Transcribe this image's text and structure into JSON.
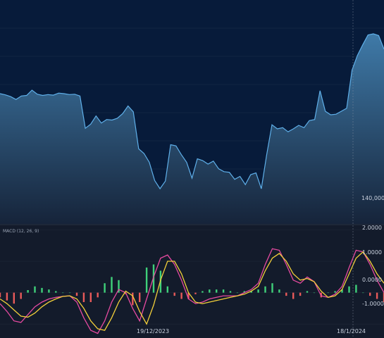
{
  "chart_data": [
    {
      "type": "area",
      "title": "",
      "x": [
        "2023-11-16",
        "2023-11-17",
        "2023-11-18",
        "2023-11-19",
        "2023-11-20",
        "2023-11-21",
        "2023-11-22",
        "2023-11-23",
        "2023-11-24",
        "2023-11-25",
        "2023-11-26",
        "2023-11-27",
        "2023-11-28",
        "2023-11-29",
        "2023-11-30",
        "2023-12-01",
        "2023-12-02",
        "2023-12-03",
        "2023-12-04",
        "2023-12-05",
        "2023-12-06",
        "2023-12-07",
        "2023-12-08",
        "2023-12-09",
        "2023-12-10",
        "2023-12-11",
        "2023-12-12",
        "2023-12-13",
        "2023-12-14",
        "2023-12-15",
        "2023-12-16",
        "2023-12-17",
        "2023-12-18",
        "2023-12-19",
        "2023-12-20",
        "2023-12-21",
        "2023-12-22",
        "2023-12-23",
        "2023-12-24",
        "2023-12-25",
        "2023-12-26",
        "2023-12-27",
        "2023-12-28",
        "2023-12-29",
        "2023-12-30",
        "2023-12-31",
        "2024-01-01",
        "2024-01-02",
        "2024-01-03",
        "2024-01-04",
        "2024-01-05",
        "2024-01-06",
        "2024-01-07",
        "2024-01-08",
        "2024-01-09",
        "2024-01-10",
        "2024-01-11",
        "2024-01-12",
        "2024-01-13",
        "2024-01-14",
        "2024-01-15",
        "2024-01-16",
        "2024-01-17",
        "2024-01-18",
        "2024-01-19",
        "2024-01-20",
        "2024-01-21",
        "2024-01-22",
        "2024-01-23",
        "2024-01-24"
      ],
      "values": [
        148000,
        147980,
        147950,
        147900,
        147960,
        147970,
        148060,
        147990,
        147970,
        147985,
        147975,
        148010,
        148000,
        147985,
        147990,
        147960,
        147410,
        147480,
        147620,
        147500,
        147560,
        147550,
        147580,
        147660,
        147790,
        147690,
        147060,
        146980,
        146830,
        146520,
        146380,
        146510,
        147130,
        147110,
        146960,
        146830,
        146560,
        146890,
        146860,
        146800,
        146850,
        146720,
        146670,
        146660,
        146540,
        146590,
        146450,
        146620,
        146650,
        146380,
        146960,
        147470,
        147400,
        147420,
        147350,
        147400,
        147460,
        147420,
        147540,
        147560,
        148050,
        147700,
        147640,
        147650,
        147700,
        147750,
        148400,
        148650,
        148830,
        149000,
        149020,
        148990,
        148760
      ],
      "ytick_labels": [
        "140,0000"
      ],
      "xtick_labels": [
        "19/12/2023",
        "18/1/2024"
      ],
      "grid": true,
      "line_color": "#5fb0ea",
      "fill_top": "#3f7aa8",
      "fill_bottom": "#16243a",
      "background": "#071b3a"
    },
    {
      "type": "line",
      "title": "MACD (12, 26, 9)",
      "ytick_labels": [
        "2.0000",
        "1.0000",
        "0.0000",
        "-1.0000"
      ],
      "ylim": [
        -1.4,
        2.1
      ],
      "series": [
        {
          "name": "",
          "color": "#e54aa0",
          "values": [
            -0.35,
            -0.6,
            -0.9,
            -0.95,
            -0.7,
            -0.45,
            -0.3,
            -0.2,
            -0.15,
            -0.12,
            -0.1,
            -0.3,
            -0.8,
            -1.2,
            -1.3,
            -0.9,
            -0.3,
            0.1,
            0.0,
            -0.5,
            -0.9,
            -0.2,
            0.5,
            1.1,
            1.2,
            0.9,
            0.4,
            -0.2,
            -0.35,
            -0.3,
            -0.2,
            -0.15,
            -0.1,
            -0.1,
            -0.1,
            0.0,
            0.1,
            0.3,
            0.9,
            1.4,
            1.35,
            0.9,
            0.4,
            0.3,
            0.5,
            0.35,
            -0.1,
            -0.15,
            -0.05,
            0.2,
            0.8,
            1.35,
            1.3,
            0.9,
            0.4,
            0.0
          ]
        },
        {
          "name": "",
          "color": "#f2cf3a",
          "values": [
            -0.2,
            -0.35,
            -0.55,
            -0.75,
            -0.78,
            -0.65,
            -0.45,
            -0.3,
            -0.2,
            -0.12,
            -0.1,
            -0.2,
            -0.5,
            -0.9,
            -1.15,
            -1.2,
            -0.8,
            -0.3,
            0.05,
            -0.1,
            -0.6,
            -1.0,
            -0.4,
            0.4,
            1.0,
            1.0,
            0.6,
            0.0,
            -0.3,
            -0.35,
            -0.3,
            -0.25,
            -0.2,
            -0.15,
            -0.1,
            -0.05,
            0.05,
            0.2,
            0.7,
            1.1,
            1.25,
            1.0,
            0.6,
            0.4,
            0.45,
            0.35,
            0.05,
            -0.15,
            -0.1,
            0.1,
            0.6,
            1.1,
            1.3,
            1.0,
            0.6,
            0.3
          ]
        },
        {
          "name": "",
          "type": "histogram",
          "color_pos": "#3fd07a",
          "color_neg": "#e85a5a",
          "values": [
            -0.15,
            -0.25,
            -0.35,
            -0.2,
            0.08,
            0.2,
            0.15,
            0.1,
            0.05,
            0.0,
            0.0,
            -0.1,
            -0.3,
            -0.3,
            -0.15,
            0.3,
            0.5,
            0.4,
            -0.05,
            -0.4,
            -0.3,
            0.8,
            0.9,
            0.7,
            0.2,
            -0.1,
            -0.2,
            -0.2,
            -0.05,
            0.05,
            0.1,
            0.1,
            0.1,
            0.05,
            0.0,
            0.05,
            0.05,
            0.1,
            0.2,
            0.3,
            0.1,
            -0.1,
            -0.2,
            -0.1,
            0.05,
            0.0,
            -0.15,
            0.0,
            0.05,
            0.1,
            0.2,
            0.25,
            0.0,
            -0.1,
            -0.2,
            -0.3
          ]
        }
      ],
      "background": "#131b2b"
    }
  ]
}
